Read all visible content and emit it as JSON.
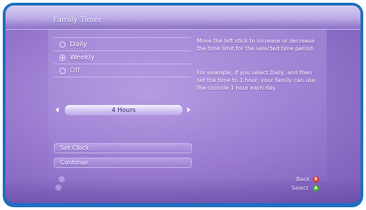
{
  "header": {
    "title": "Family Timer"
  },
  "options": [
    {
      "label": "Daily",
      "selected": false
    },
    {
      "label": "Weekly",
      "selected": true
    },
    {
      "label": "Off",
      "selected": false
    }
  ],
  "description": {
    "line1": "Move the left stick to increase or decrease the time limit for the selected time period.",
    "line2": "For example, if you select Daily, and then set the time to 1 hour, your family can use the console 1 hour each day."
  },
  "slider": {
    "value": "4 Hours"
  },
  "buttons": {
    "set_clock": "Set Clock",
    "continue": "Continue"
  },
  "footer": {
    "back_label": "Back",
    "back_button_letter": "B",
    "back_color": "#e0302a",
    "select_label": "Select",
    "select_button_letter": "A",
    "select_color": "#3fae2e"
  },
  "colors": {
    "frame": "#1d6fc0",
    "background": "#9a7bd0"
  }
}
